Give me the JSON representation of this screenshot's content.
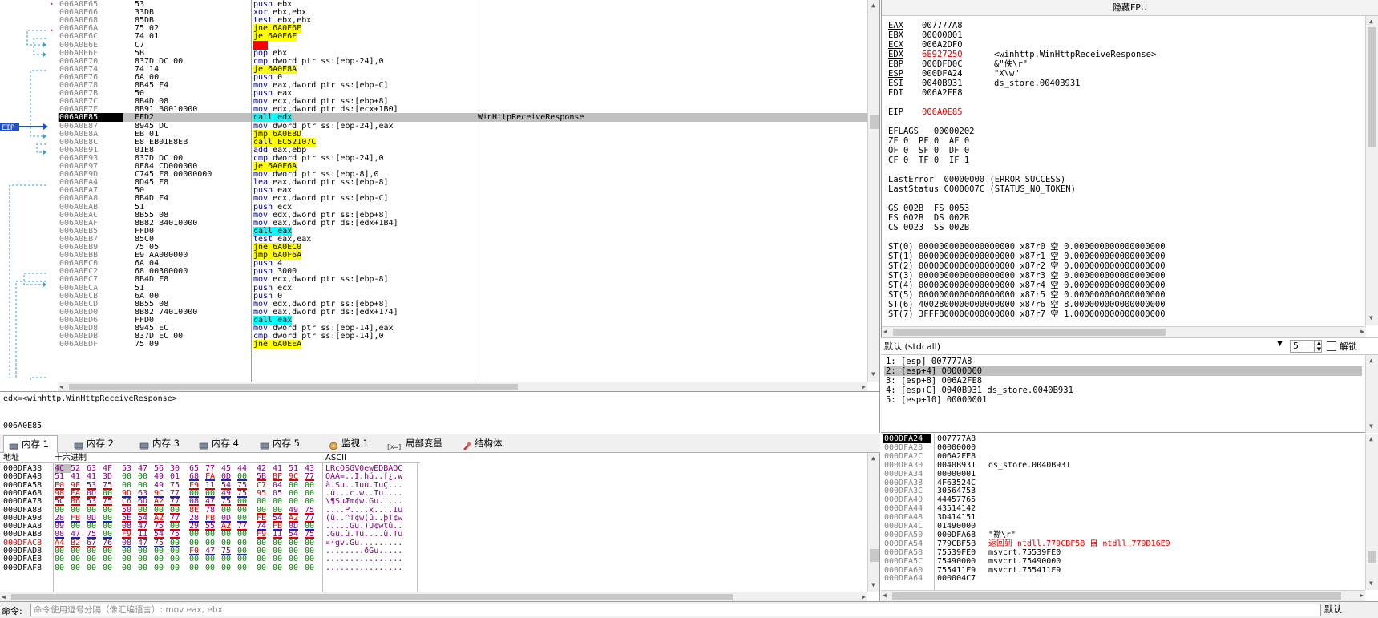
{
  "disasm": {
    "eip_label": "EIP",
    "rows": [
      {
        "addr": "006A0E65",
        "bytes": "53",
        "instr": "push ebx"
      },
      {
        "addr": "006A0E66",
        "bytes": "33DB",
        "instr": "xor ebx,ebx"
      },
      {
        "addr": "006A0E68",
        "bytes": "85DB",
        "instr": "test ebx,ebx"
      },
      {
        "addr": "006A0E6A",
        "bytes": "75 02",
        "instr": "jne 6A0E6E",
        "hl": "y"
      },
      {
        "addr": "006A0E6C",
        "bytes": "74 01",
        "instr": "je 6A0E6F",
        "hl": "y"
      },
      {
        "addr": "006A0E6E",
        "bytes": "C7",
        "instr": "???",
        "hl": "r"
      },
      {
        "addr": "006A0E6F",
        "bytes": "5B",
        "instr": "pop ebx"
      },
      {
        "addr": "006A0E70",
        "bytes": "837D DC 00",
        "instr": "cmp dword ptr ss:[ebp-24],0"
      },
      {
        "addr": "006A0E74",
        "bytes": "74 14",
        "instr": "je 6A0E8A",
        "hl": "y"
      },
      {
        "addr": "006A0E76",
        "bytes": "6A 00",
        "instr": "push 0"
      },
      {
        "addr": "006A0E78",
        "bytes": "8B45 F4",
        "instr": "mov eax,dword ptr ss:[ebp-C]"
      },
      {
        "addr": "006A0E7B",
        "bytes": "50",
        "instr": "push eax"
      },
      {
        "addr": "006A0E7C",
        "bytes": "8B4D 08",
        "instr": "mov ecx,dword ptr ss:[ebp+8]"
      },
      {
        "addr": "006A0E7F",
        "bytes": "8B91 B0010000",
        "instr": "mov edx,dword ptr ds:[ecx+1B0]"
      },
      {
        "addr": "006A0E85",
        "bytes": "FFD2",
        "instr": "call edx",
        "hl": "c",
        "cur": true,
        "cmt": "WinHttpReceiveResponse"
      },
      {
        "addr": "006A0E87",
        "bytes": "8945 DC",
        "instr": "mov dword ptr ss:[ebp-24],eax"
      },
      {
        "addr": "006A0E8A",
        "bytes": "EB 01",
        "instr": "jmp 6A0E8D",
        "hl": "y"
      },
      {
        "addr": "006A0E8C",
        "bytes": "E8 EB01E8EB",
        "instr": "call EC52107C",
        "hl": "y"
      },
      {
        "addr": "006A0E91",
        "bytes": "01E8",
        "instr": "add eax,ebp"
      },
      {
        "addr": "006A0E93",
        "bytes": "837D DC 00",
        "instr": "cmp dword ptr ss:[ebp-24],0"
      },
      {
        "addr": "006A0E97",
        "bytes": "0F84 CD000000",
        "instr": "je 6A0F6A",
        "hl": "y"
      },
      {
        "addr": "006A0E9D",
        "bytes": "C745 F8 00000000",
        "instr": "mov dword ptr ss:[ebp-8],0"
      },
      {
        "addr": "006A0EA4",
        "bytes": "8D45 F8",
        "instr": "lea eax,dword ptr ss:[ebp-8]"
      },
      {
        "addr": "006A0EA7",
        "bytes": "50",
        "instr": "push eax"
      },
      {
        "addr": "006A0EA8",
        "bytes": "8B4D F4",
        "instr": "mov ecx,dword ptr ss:[ebp-C]"
      },
      {
        "addr": "006A0EAB",
        "bytes": "51",
        "instr": "push ecx"
      },
      {
        "addr": "006A0EAC",
        "bytes": "8B55 08",
        "instr": "mov edx,dword ptr ss:[ebp+8]"
      },
      {
        "addr": "006A0EAF",
        "bytes": "8B82 B4010000",
        "instr": "mov eax,dword ptr ds:[edx+1B4]"
      },
      {
        "addr": "006A0EB5",
        "bytes": "FFD0",
        "instr": "call eax",
        "hl": "c"
      },
      {
        "addr": "006A0EB7",
        "bytes": "85C0",
        "instr": "test eax,eax"
      },
      {
        "addr": "006A0EB9",
        "bytes": "75 05",
        "instr": "jne 6A0EC0",
        "hl": "y"
      },
      {
        "addr": "006A0EBB",
        "bytes": "E9 AA000000",
        "instr": "jmp 6A0F6A",
        "hl": "y"
      },
      {
        "addr": "006A0EC0",
        "bytes": "6A 04",
        "instr": "push 4"
      },
      {
        "addr": "006A0EC2",
        "bytes": "68 00300000",
        "instr": "push 3000"
      },
      {
        "addr": "006A0EC7",
        "bytes": "8B4D F8",
        "instr": "mov ecx,dword ptr ss:[ebp-8]"
      },
      {
        "addr": "006A0ECA",
        "bytes": "51",
        "instr": "push ecx"
      },
      {
        "addr": "006A0ECB",
        "bytes": "6A 00",
        "instr": "push 0"
      },
      {
        "addr": "006A0ECD",
        "bytes": "8B55 08",
        "instr": "mov edx,dword ptr ss:[ebp+8]"
      },
      {
        "addr": "006A0ED0",
        "bytes": "8B82 74010000",
        "instr": "mov eax,dword ptr ds:[edx+174]"
      },
      {
        "addr": "006A0ED6",
        "bytes": "FFD0",
        "instr": "call eax",
        "hl": "c"
      },
      {
        "addr": "006A0ED8",
        "bytes": "8945 EC",
        "instr": "mov dword ptr ss:[ebp-14],eax"
      },
      {
        "addr": "006A0EDB",
        "bytes": "837D EC 00",
        "instr": "cmp dword ptr ss:[ebp-14],0"
      },
      {
        "addr": "006A0EDF",
        "bytes": "75 09",
        "instr": "jne 6A0EEA",
        "hl": "y"
      }
    ]
  },
  "info": {
    "line1": "edx=<winhttp.WinHttpReceiveResponse>",
    "line2": "006A0E85"
  },
  "registers": {
    "header": "隐藏FPU",
    "lines": [
      {
        "name": "EAX",
        "val": "007777A8",
        "u": true
      },
      {
        "name": "EBX",
        "val": "00000001"
      },
      {
        "name": "ECX",
        "val": "006A2DF0",
        "u": true
      },
      {
        "name": "EDX",
        "val": "6E927250",
        "u": true,
        "red": true,
        "cmt": "<winhttp.WinHttpReceiveResponse>"
      },
      {
        "name": "EBP",
        "val": "000DFD0C",
        "cmt": "&\"佚\\r\""
      },
      {
        "name": "ESP",
        "val": "000DFA24",
        "u": true,
        "cmt": "\"X\\w\""
      },
      {
        "name": "ESI",
        "val": "0040B931",
        "cmt": "ds_store.0040B931"
      },
      {
        "name": "EDI",
        "val": "006A2FE8"
      },
      {
        "name": "",
        "val": ""
      },
      {
        "name": "EIP",
        "val": "006A0E85",
        "red": true
      },
      {
        "name": "",
        "val": ""
      },
      {
        "raw": "EFLAGS   00000202"
      },
      {
        "raw": "ZF 0  PF 0  AF 0"
      },
      {
        "raw": "OF 0  SF 0  DF 0"
      },
      {
        "raw": "CF 0  TF 0  IF 1"
      },
      {
        "raw": ""
      },
      {
        "raw": "LastError  00000000 (ERROR_SUCCESS)"
      },
      {
        "raw": "LastStatus C000007C (STATUS_NO_TOKEN)"
      },
      {
        "raw": ""
      },
      {
        "raw": "GS 002B  FS 0053"
      },
      {
        "raw": "ES 002B  DS 002B"
      },
      {
        "raw": "CS 0023  SS 002B"
      },
      {
        "raw": ""
      },
      {
        "raw": "ST(0) 0000000000000000000 x87r0 空 0.000000000000000000"
      },
      {
        "raw": "ST(1) 0000000000000000000 x87r1 空 0.000000000000000000"
      },
      {
        "raw": "ST(2) 0000000000000000000 x87r2 空 0.000000000000000000"
      },
      {
        "raw": "ST(3) 0000000000000000000 x87r3 空 0.000000000000000000"
      },
      {
        "raw": "ST(4) 0000000000000000000 x87r4 空 0.000000000000000000"
      },
      {
        "raw": "ST(5) 0000000000000000000 x87r5 空 0.000000000000000000"
      },
      {
        "raw": "ST(6) 4002800000000000000 x87r6 空 8.000000000000000000"
      },
      {
        "raw": "ST(7) 3FFF800000000000000 x87r7 空 1.000000000000000000"
      }
    ]
  },
  "callconv": {
    "selected": "默认 (stdcall)",
    "arg_count": "5",
    "unlock_label": "解锁"
  },
  "args": [
    {
      "text": "1: [esp] 007777A8"
    },
    {
      "text": "2: [esp+4] 00000000",
      "sel": true
    },
    {
      "text": "3: [esp+8] 006A2FE8"
    },
    {
      "text": "4: [esp+C] 0040B931 ds_store.0040B931"
    },
    {
      "text": "5: [esp+10] 00000001"
    }
  ],
  "tabs": [
    {
      "label": "内存 1",
      "active": true,
      "icon": "memory-icon"
    },
    {
      "label": "内存 2",
      "icon": "memory-icon"
    },
    {
      "label": "内存 3",
      "icon": "memory-icon"
    },
    {
      "label": "内存 4",
      "icon": "memory-icon"
    },
    {
      "label": "内存 5",
      "icon": "memory-icon"
    },
    {
      "label": "监视 1",
      "icon": "watch-icon"
    },
    {
      "label": "局部变量",
      "icon": "locals-icon",
      "prefix": "[x=]"
    },
    {
      "label": "结构体",
      "icon": "struct-icon"
    }
  ],
  "dump": {
    "col_addr": "地址",
    "col_hex": "十六进制",
    "col_ascii": "ASCII",
    "rows": [
      {
        "addr": "000DFA38",
        "hex": [
          "4C",
          "52",
          "63",
          "4F",
          "53",
          "47",
          "56",
          "30",
          "65",
          "77",
          "45",
          "44",
          "42",
          "41",
          "51",
          "43"
        ],
        "ascii": "LRcOSGV0ewEDBAQC"
      },
      {
        "addr": "000DFA48",
        "hex": [
          "51",
          "41",
          "41",
          "3D",
          "00",
          "00",
          "49",
          "01",
          "68",
          "FA",
          "0D",
          "00",
          "5B",
          "BF",
          "9C",
          "77"
        ],
        "ascii": "QAA=..I.hú..[¿.w"
      },
      {
        "addr": "000DFA58",
        "hex": [
          "E0",
          "9F",
          "53",
          "75",
          "00",
          "00",
          "49",
          "75",
          "F9",
          "11",
          "54",
          "75",
          "C7",
          "04",
          "00",
          "00"
        ],
        "ascii": "à.Su..Iuù.TuÇ..."
      },
      {
        "addr": "000DFA68",
        "hex": [
          "98",
          "FA",
          "0D",
          "00",
          "9D",
          "63",
          "9C",
          "77",
          "00",
          "00",
          "49",
          "75",
          "95",
          "05",
          "00",
          "00"
        ],
        "ascii": ".ú...c.w..Iu...."
      },
      {
        "addr": "000DFA78",
        "hex": [
          "5C",
          "B6",
          "53",
          "75",
          "C6",
          "6D",
          "A2",
          "77",
          "08",
          "47",
          "75",
          "00",
          "00",
          "00",
          "00",
          "00"
        ],
        "ascii": "\\¶SuÆm¢w.Gu....."
      },
      {
        "addr": "000DFA88",
        "hex": [
          "00",
          "00",
          "00",
          "00",
          "50",
          "00",
          "00",
          "00",
          "8E",
          "78",
          "00",
          "00",
          "00",
          "00",
          "49",
          "75"
        ],
        "ascii": "....P....x....Iu"
      },
      {
        "addr": "000DFA98",
        "hex": [
          "28",
          "FB",
          "0D",
          "00",
          "5E",
          "54",
          "A2",
          "77",
          "28",
          "FB",
          "0D",
          "00",
          "FE",
          "54",
          "A2",
          "77"
        ],
        "ascii": "(û..^T¢w(û..þT¢w"
      },
      {
        "addr": "000DFAA8",
        "hex": [
          "09",
          "00",
          "00",
          "00",
          "08",
          "47",
          "75",
          "00",
          "29",
          "55",
          "A2",
          "77",
          "74",
          "FB",
          "0D",
          "00"
        ],
        "ascii": ".....Gu.)U¢wtû.."
      },
      {
        "addr": "000DFAB8",
        "hex": [
          "08",
          "47",
          "75",
          "00",
          "F9",
          "11",
          "54",
          "75",
          "00",
          "00",
          "00",
          "00",
          "F9",
          "11",
          "54",
          "75"
        ],
        "ascii": ".Gu.ù.Tu....ù.Tu"
      },
      {
        "addr": "000DFAC8",
        "hex": [
          "A4",
          "B2",
          "67",
          "76",
          "08",
          "47",
          "75",
          "00",
          "00",
          "00",
          "00",
          "00",
          "00",
          "00",
          "00",
          "00"
        ],
        "ascii": "¤²gv.Gu........."
      },
      {
        "addr": "000DFAD8",
        "hex": [
          "00",
          "00",
          "00",
          "00",
          "00",
          "00",
          "00",
          "00",
          "F0",
          "47",
          "75",
          "00",
          "00",
          "00",
          "00",
          "00"
        ],
        "ascii": "........ðGu....."
      },
      {
        "addr": "000DFAE8",
        "hex": [
          "00",
          "00",
          "00",
          "00",
          "00",
          "00",
          "00",
          "00",
          "00",
          "00",
          "00",
          "00",
          "00",
          "00",
          "00",
          "00"
        ],
        "ascii": "................"
      },
      {
        "addr": "000DFAF8",
        "hex": [
          "00",
          "00",
          "00",
          "00",
          "00",
          "00",
          "00",
          "00",
          "00",
          "00",
          "00",
          "00",
          "00",
          "00",
          "00",
          "00"
        ],
        "ascii": "................"
      }
    ]
  },
  "stack": {
    "rows": [
      {
        "addr": "000DFA24",
        "val": "007777A8",
        "cur": true
      },
      {
        "addr": "000DFA28",
        "val": "00000000"
      },
      {
        "addr": "000DFA2C",
        "val": "006A2FE8"
      },
      {
        "addr": "000DFA30",
        "val": "0040B931",
        "cmt": "ds_store.0040B931"
      },
      {
        "addr": "000DFA34",
        "val": "00000001"
      },
      {
        "addr": "000DFA38",
        "val": "4F63524C"
      },
      {
        "addr": "000DFA3C",
        "val": "30564753"
      },
      {
        "addr": "000DFA40",
        "val": "44457765"
      },
      {
        "addr": "000DFA44",
        "val": "43514142"
      },
      {
        "addr": "000DFA48",
        "val": "3D414151"
      },
      {
        "addr": "000DFA4C",
        "val": "01490000"
      },
      {
        "addr": "000DFA50",
        "val": "000DFA68",
        "cmt": "\"襟\\r\""
      },
      {
        "addr": "000DFA54",
        "val": "779CBF5B",
        "cmt": "返回到 ntdll.779CBF5B 自 ntdll.779D16E9",
        "red": true
      },
      {
        "addr": "000DFA58",
        "val": "75539FE0",
        "cmt": "msvcrt.75539FE0"
      },
      {
        "addr": "000DFA5C",
        "val": "75490000",
        "cmt": "msvcrt.75490000"
      },
      {
        "addr": "000DFA60",
        "val": "755411F9",
        "cmt": "msvcrt.755411F9"
      },
      {
        "addr": "000DFA64",
        "val": "000004C7"
      }
    ]
  },
  "command": {
    "label": "命令:",
    "placeholder": "命令使用逗号分隔（像汇编语言）: mov eax, ebx",
    "mode": "默认"
  }
}
